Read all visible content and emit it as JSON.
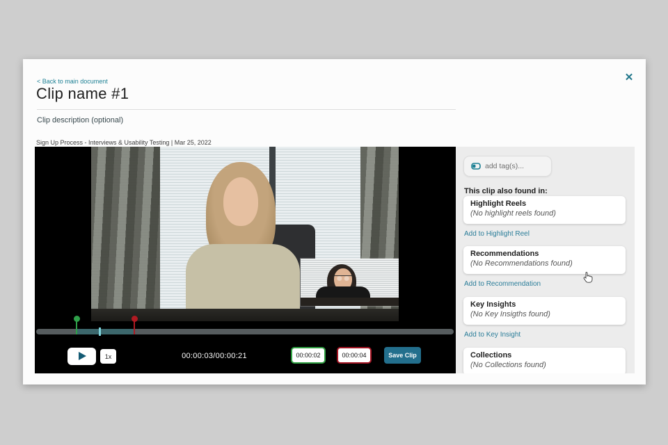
{
  "modal": {
    "back_link": "< Back to main document",
    "title": "Clip name #1",
    "description_placeholder": "Clip description (optional)",
    "source_meta": "Sign Up Process - Interviews & Usability Testing | Mar 25, 2022",
    "close_icon": "✕"
  },
  "player": {
    "time_display": "00:00:03/00:00:21",
    "speed_label": "1x",
    "clip_start": "00:00:02",
    "clip_end": "00:00:04",
    "save_button": "Save Clip",
    "timeline": {
      "selection_start_pct": 9.7,
      "playhead_pct": 15.2,
      "selection_end_pct": 23.5
    }
  },
  "sidebar": {
    "tag_placeholder": "add tag(s)...",
    "found_in_label": "This clip also found in:",
    "sections": [
      {
        "title": "Highlight Reels",
        "empty_text": "(No highlight reels found)",
        "action": "Add to Highlight Reel"
      },
      {
        "title": "Recommendations",
        "empty_text": "(No Recommendations found)",
        "action": "Add to Recommendation"
      },
      {
        "title": "Key Insights",
        "empty_text": "(No Key Insigths found)",
        "action": "Add to Key Insight"
      },
      {
        "title": "Collections",
        "empty_text": "(No Collections found)",
        "action": ""
      }
    ]
  },
  "colors": {
    "accent_teal": "#1b7f93",
    "save_button": "#236f8d",
    "clip_start_green": "#2fa042",
    "clip_end_red": "#a31423",
    "timeline_selection": "#3c676c",
    "page_background": "#cecece"
  }
}
